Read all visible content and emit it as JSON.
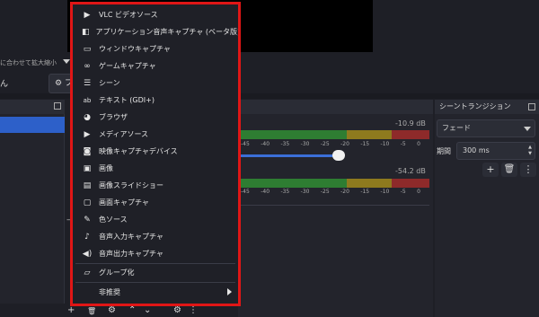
{
  "top": {
    "scale_text": "に合わせて拡大縮小",
    "left_text": "ん",
    "properties_button": "プ"
  },
  "mixer": {
    "db1": "-10.9 dB",
    "db2": "-54.2 dB",
    "ticks": [
      "-45",
      "-40",
      "-35",
      "-30",
      "-25",
      "-20",
      "-15",
      "-10",
      "-5",
      "0"
    ]
  },
  "transitions": {
    "title": "シーントランジション",
    "selected": "フェード",
    "duration_label": "期間",
    "duration_value": "300 ms"
  },
  "menu": {
    "items": [
      {
        "icon": "play-icon",
        "label": "VLC ビデオソース"
      },
      {
        "icon": "speaker-window-icon",
        "label": "アプリケーション音声キャプチャ (ベータ版)"
      },
      {
        "icon": "window-icon",
        "label": "ウィンドウキャプチャ"
      },
      {
        "icon": "gamepad-icon",
        "label": "ゲームキャプチャ"
      },
      {
        "icon": "list-icon",
        "label": "シーン"
      },
      {
        "icon": "text-icon",
        "label": "テキスト (GDI+)"
      },
      {
        "icon": "globe-icon",
        "label": "ブラウザ"
      },
      {
        "icon": "play-icon",
        "label": "メディアソース"
      },
      {
        "icon": "camera-icon",
        "label": "映像キャプチャデバイス"
      },
      {
        "icon": "image-icon",
        "label": "画像"
      },
      {
        "icon": "slideshow-icon",
        "label": "画像スライドショー"
      },
      {
        "icon": "monitor-icon",
        "label": "画面キャプチャ"
      },
      {
        "icon": "brush-icon",
        "label": "色ソース"
      },
      {
        "icon": "microphone-icon",
        "label": "音声入力キャプチャ"
      },
      {
        "icon": "volume-icon",
        "label": "音声出力キャプチャ"
      }
    ],
    "group_label": "グループ化",
    "deprecated_label": "非推奨"
  },
  "colors": {
    "highlight": "#e01616",
    "selection": "#2d60c9"
  }
}
